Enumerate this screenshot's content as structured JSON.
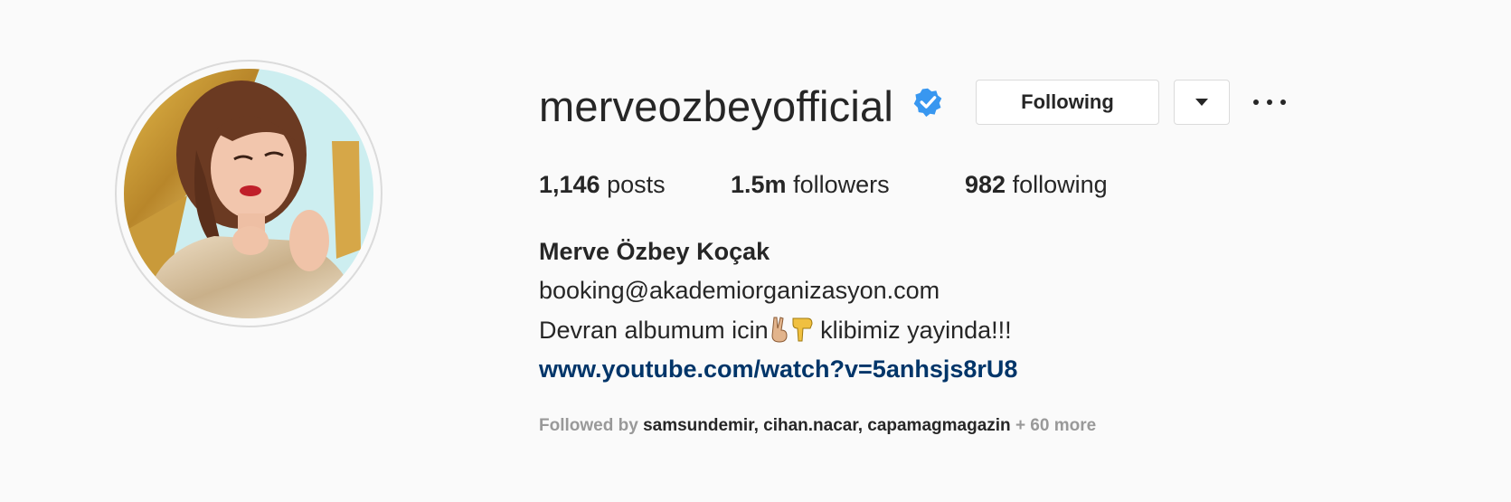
{
  "profile": {
    "username": "merveozbeyofficial",
    "verified_icon": "verified-badge-icon",
    "full_name": "Merve Özbey Koçak",
    "email": "booking@akademiorganizasyon.com",
    "bio_before": "Devran albumum icin",
    "bio_emoji_1": "victory-hand-icon",
    "bio_emoji_2": "pointing-down-icon",
    "bio_after": " klibimiz yayinda!!!",
    "link": "www.youtube.com/watch?v=5anhsjs8rU8"
  },
  "actions": {
    "following_label": "Following",
    "dropdown_icon": "caret-down-icon",
    "more_icon": "more-horizontal-icon"
  },
  "stats": {
    "posts_count": "1,146",
    "posts_label": "posts",
    "followers_count": "1.5m",
    "followers_label": "followers",
    "following_count": "982",
    "following_label": "following"
  },
  "followed_by": {
    "prefix": "Followed by",
    "users": [
      "samsundemir",
      "cihan.nacar",
      "capamagmagazin"
    ],
    "suffix": "+ 60 more"
  },
  "colors": {
    "background": "#fafafa",
    "verified_blue": "#3897f0",
    "link": "#003569",
    "text": "#262626",
    "muted": "#999999"
  }
}
